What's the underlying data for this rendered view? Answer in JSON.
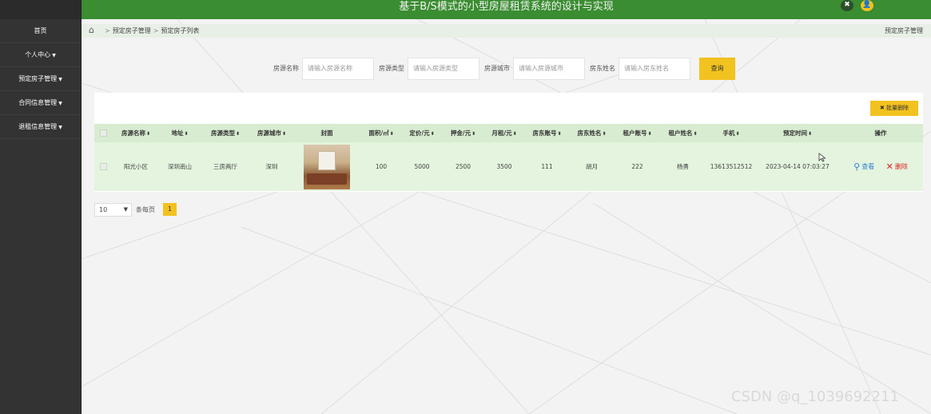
{
  "header": {
    "title": "基于B/S模式的小型房屋租赁系统的设计与实现"
  },
  "sidebar": {
    "items": [
      {
        "label": "首页",
        "dropdown": false
      },
      {
        "label": "个人中心",
        "dropdown": true
      },
      {
        "label": "预定房子管理",
        "dropdown": true
      },
      {
        "label": "合同信息管理",
        "dropdown": true
      },
      {
        "label": "退租信息管理",
        "dropdown": true
      }
    ]
  },
  "breadcrumb": {
    "items": [
      "预定房子管理",
      "预定房子列表"
    ],
    "right": "预定房子管理"
  },
  "search": {
    "fields": [
      {
        "label": "房源名称",
        "placeholder": "请输入房源名称"
      },
      {
        "label": "房源类型",
        "placeholder": "请输入房源类型"
      },
      {
        "label": "房源城市",
        "placeholder": "请输入房源城市"
      },
      {
        "label": "房东姓名",
        "placeholder": "请输入房东姓名"
      }
    ],
    "button": "查询"
  },
  "toolbar": {
    "batch_delete": "批量删除"
  },
  "table": {
    "columns": [
      "房源名称",
      "地址",
      "房源类型",
      "房源城市",
      "封面",
      "面积/㎡",
      "定价/元",
      "押金/元",
      "月租/元",
      "房东账号",
      "房东姓名",
      "租户账号",
      "租户姓名",
      "手机",
      "预定时间",
      "操作"
    ],
    "rows": [
      {
        "name": "阳光小区",
        "address": "深圳南山",
        "type": "三房两厅",
        "city": "深圳",
        "area": "100",
        "price": "5000",
        "deposit": "2500",
        "rent": "3500",
        "landlord_account": "111",
        "landlord_name": "胡月",
        "tenant_account": "222",
        "tenant_name": "杨勇",
        "phone": "13613512512",
        "reserve_time": "2023-04-14 07:03:27",
        "view": "查看",
        "delete": "删除"
      }
    ]
  },
  "pagination": {
    "page_size": "10",
    "per_page_label": "条每页",
    "current_page": "1"
  },
  "watermark": "CSDN @q_1039692211",
  "colors": {
    "header_green": "#3a8d31",
    "sidebar": "#333333",
    "accent_yellow": "#f2c21f",
    "row_green": "#e4f4de",
    "head_green": "#d8ecd1"
  }
}
